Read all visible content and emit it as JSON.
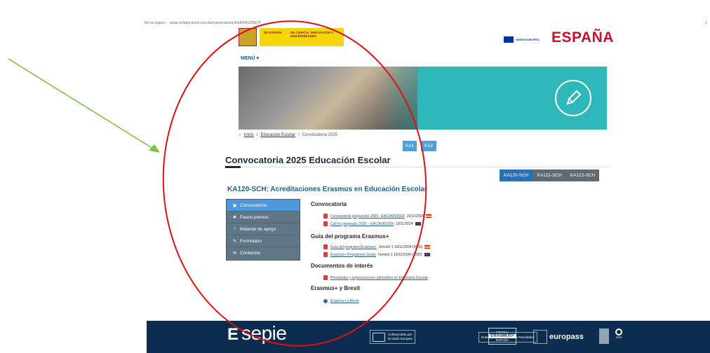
{
  "browser": {
    "security": "No es seguro",
    "url": "sepie.es/educacion-escolar/convocatoria.html#KA120SCH",
    "edge_glyph": "1"
  },
  "header": {
    "gov_label_1": "DE ESPAÑA",
    "gov_label_2": "DE CIENCIA, INNOVACIÓN Y UNIVERSIDADES",
    "eu_label": "UNIÓN EUROPEA",
    "espana": "ESPAÑA"
  },
  "menu_label": "MENÚ ▾",
  "breadcrumb": {
    "home": "Inicio",
    "section": "Educación Escolar",
    "current": "Convocatoria 2025",
    "separator": "/"
  },
  "ka_buttons": [
    "KA1",
    "KA2"
  ],
  "page_title": "Convocatoria 2025 Educación Escolar",
  "tabs": [
    {
      "label": "KA120-SCH",
      "active": true
    },
    {
      "label": "KA121-SCH",
      "active": false
    },
    {
      "label": "KA122-SCH",
      "active": false
    }
  ],
  "subtitle": "KA120-SCH: Acreditaciones Erasmus en Educación Escolar",
  "side_menu": [
    {
      "label": "Convocatoria",
      "icon": "book-icon",
      "glyph": "▣",
      "active": true
    },
    {
      "label": "Pasos previos",
      "icon": "gear-icon",
      "glyph": "✱",
      "active": false
    },
    {
      "label": "Material de apoyo",
      "icon": "info-icon",
      "glyph": "i",
      "active": false
    },
    {
      "label": "Formulario",
      "icon": "pencil-icon",
      "glyph": "✎",
      "active": false
    },
    {
      "label": "Contactos",
      "icon": "envelope-icon",
      "glyph": "✉",
      "active": false
    }
  ],
  "content": {
    "convocatoria": {
      "heading": "Convocatoria",
      "items": [
        {
          "link": "Convocatoria propuestas 2025 - EAC/A08/2024",
          "suffix": "19/11/2024",
          "flag": "es"
        },
        {
          "link": "Call for proposals 2025 – EAC/A08/2024",
          "suffix": "19/11/2024",
          "flag": "uk"
        }
      ]
    },
    "guia": {
      "heading": "Guía del programa Erasmus+",
      "items": [
        {
          "link": "Guía del programa Erasmus+",
          "suffix": "Versión 1 19/11/2024 (2025)",
          "flag": "es"
        },
        {
          "link": "Erasmus+ Programme Guide",
          "suffix": "Version 1 19/11/2024 (2025)",
          "flag": "uk"
        }
      ]
    },
    "documentos": {
      "heading": "Documentos de interés",
      "items": [
        {
          "link": "Prioridades y organizaciones admisibles en Educación Escolar",
          "suffix": ""
        }
      ]
    },
    "brexit": {
      "heading": "Erasmus+ y Brexit",
      "items": [
        {
          "link": "Erasmus+ y Brexit",
          "suffix": ""
        }
      ]
    }
  },
  "footer": {
    "sepie": "sepie",
    "cofin_1": "Cofinanciado por",
    "cofin_2": "la Unión Europea",
    "portal_top": "PORTAL",
    "portal_main": "ERASMUS+",
    "portal_bottom": "ESPAÑA",
    "erasmus_small": "Erasmus+",
    "plataforma": "Plataforma de Resultados",
    "europass": "europass",
    "agenda_year": "2030"
  },
  "colors": {
    "accent_blue": "#2c6fb5",
    "side_menu_bg": "#5f7686",
    "footer_bg": "#0c2d4f",
    "banner_teal": "#2fb8ba",
    "annotation_red": "#e01010",
    "annotation_green": "#7dc243"
  }
}
